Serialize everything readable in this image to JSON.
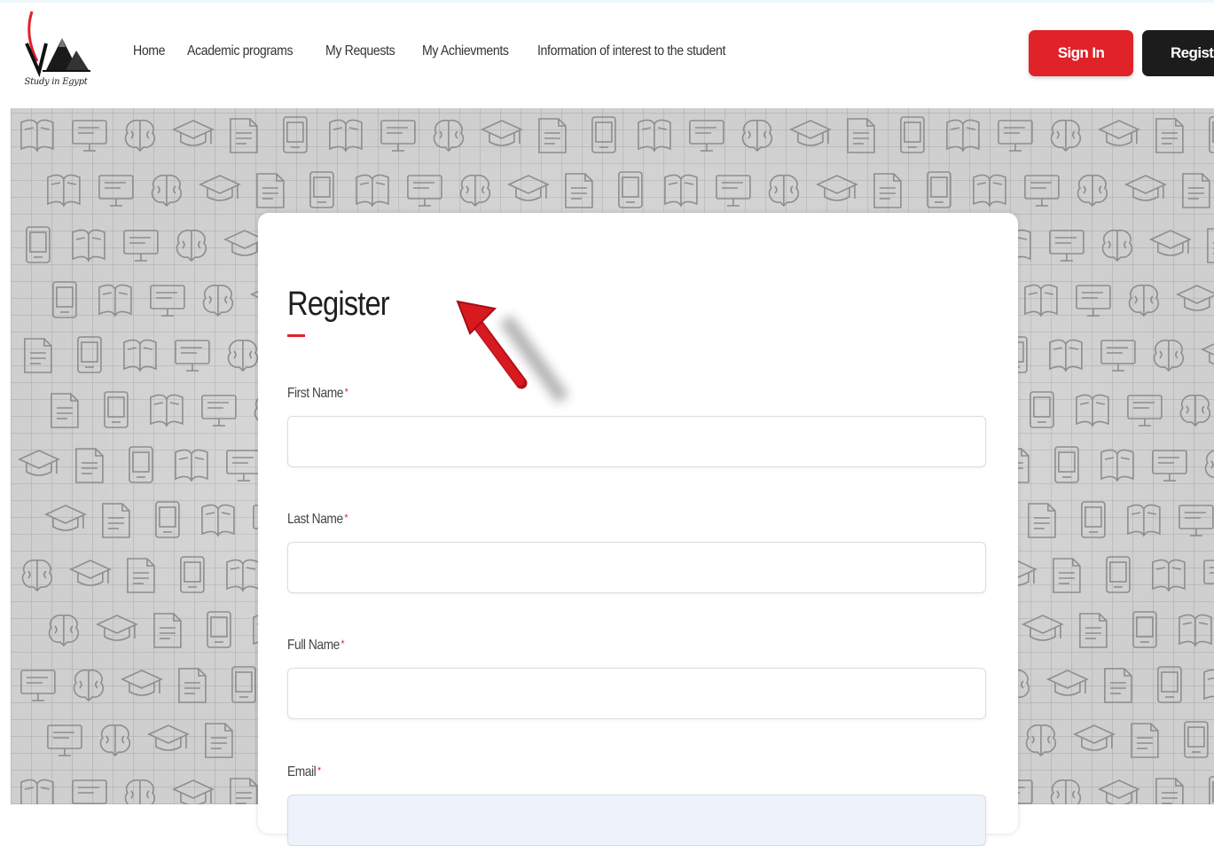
{
  "header": {
    "logo_caption": "Study in Egypt",
    "nav": [
      "Home",
      "Academic programs",
      "My Requests",
      "My Achievments",
      "Information of interest to the student"
    ],
    "signin_label": "Sign In",
    "register_label": "Register"
  },
  "form": {
    "title": "Register",
    "fields": [
      {
        "label": "First Name",
        "required_mark": "*",
        "value": "",
        "placeholder": ""
      },
      {
        "label": "Last Name",
        "required_mark": "*",
        "value": "",
        "placeholder": ""
      },
      {
        "label": "Full Name",
        "required_mark": "*",
        "value": "",
        "placeholder": ""
      },
      {
        "label": "Email",
        "required_mark": "*",
        "value": "",
        "placeholder": ""
      }
    ]
  },
  "colors": {
    "accent_red": "#e02229",
    "dark_button": "#1c1c1c",
    "pattern_gray": "#cfcfcf"
  },
  "icons": {
    "logo": "study-in-egypt-pyramid-logo",
    "annotation": "red-arrow-pointer"
  }
}
